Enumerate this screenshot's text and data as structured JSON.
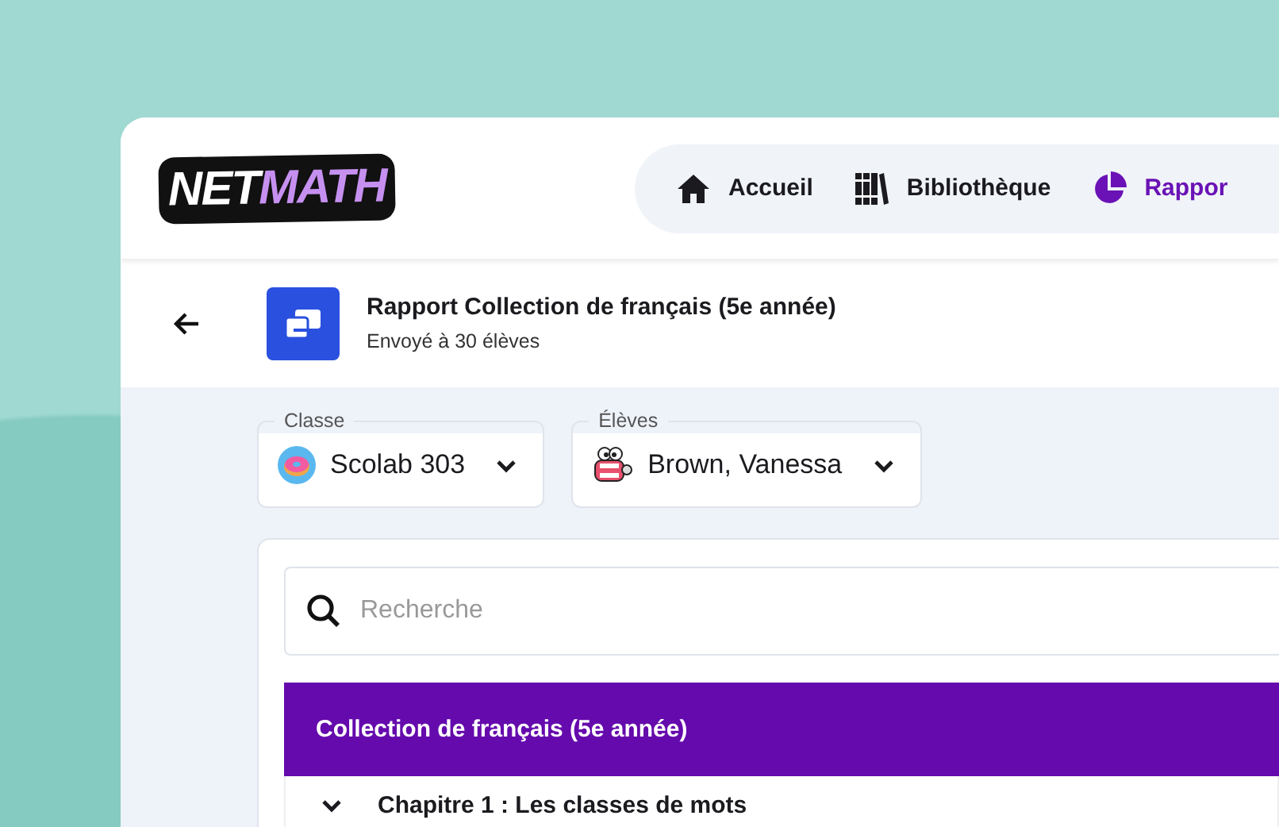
{
  "logo": {
    "part_1": "NET",
    "part_2": "MATH"
  },
  "nav": [
    {
      "label": "Accueil",
      "selected": false
    },
    {
      "label": "Bibliothèque",
      "selected": false
    },
    {
      "label": "Rappor",
      "selected": true
    }
  ],
  "report": {
    "title": "Rapport Collection de français (5e année)",
    "subtitle": "Envoyé à 30 élèves"
  },
  "filters": [
    {
      "label": "Classe",
      "value": "Scolab 303"
    },
    {
      "label": "Élèves",
      "value": "Brown, Vanessa"
    }
  ],
  "search": {
    "placeholder": "Recherche"
  },
  "collection": {
    "title": "Collection de français (5e année)",
    "chapters": [
      {
        "label": "Chapitre 1 : Les classes de mots",
        "expanded": true
      }
    ]
  }
}
